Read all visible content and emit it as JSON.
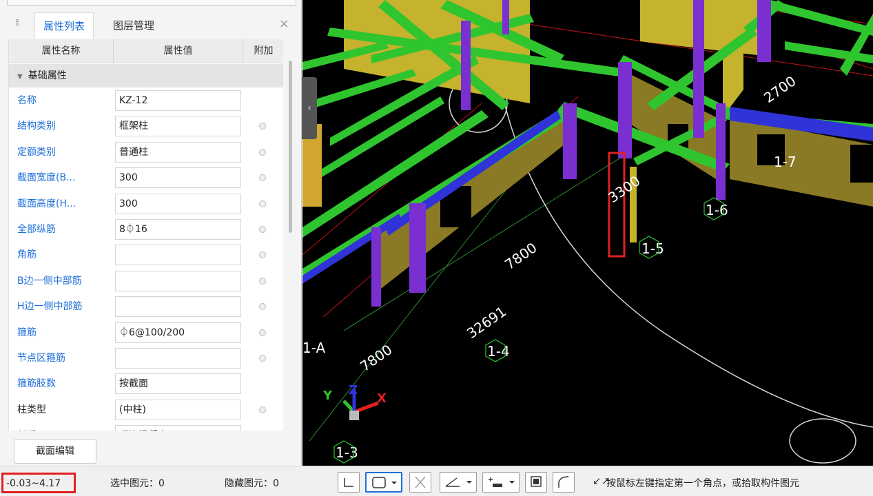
{
  "tabs": {
    "properties": "属性列表",
    "layers": "图层管理"
  },
  "close_glyph": "×",
  "columns": {
    "name": "属性名称",
    "value": "属性值",
    "extra": "附加"
  },
  "section": {
    "label": "基础属性",
    "toggle_glyph": "▼"
  },
  "rows": [
    {
      "label": "名称",
      "value": "KZ-12",
      "blue": true,
      "extra": false
    },
    {
      "label": "结构类别",
      "value": "框架柱",
      "blue": true,
      "extra": true
    },
    {
      "label": "定额类别",
      "value": "普通柱",
      "blue": true,
      "extra": true
    },
    {
      "label": "截面宽度(B...",
      "value": "300",
      "blue": true,
      "extra": true
    },
    {
      "label": "截面高度(H...",
      "value": "300",
      "blue": true,
      "extra": true
    },
    {
      "label": "全部纵筋",
      "value": "8⏀16",
      "blue": true,
      "extra": true
    },
    {
      "label": "角筋",
      "value": "",
      "blue": true,
      "extra": true
    },
    {
      "label": "B边一侧中部筋",
      "value": "",
      "blue": true,
      "extra": true
    },
    {
      "label": "H边一侧中部筋",
      "value": "",
      "blue": true,
      "extra": true
    },
    {
      "label": "箍筋",
      "value": "⏀6@100/200",
      "blue": true,
      "extra": true
    },
    {
      "label": "节点区箍筋",
      "value": "",
      "blue": true,
      "extra": true
    },
    {
      "label": "箍筋肢数",
      "value": "按截面",
      "blue": true,
      "extra": false
    },
    {
      "label": "柱类型",
      "value": "(中柱)",
      "blue": false,
      "extra": true
    },
    {
      "label": "材质",
      "value": "现浇混凝土",
      "blue": true,
      "extra": true
    }
  ],
  "buttons": {
    "section_edit": "截面编辑"
  },
  "status": {
    "elevation": "-0.03~4.17",
    "selected": "选中图元：0",
    "hidden": "隐藏图元：0",
    "hint_icon": "↙↗",
    "hint": "按鼠标左键指定第一个角点，或拾取构件图元"
  },
  "viewport": {
    "dimensions": [
      "7800",
      "7800",
      "32691",
      "3300",
      "2700"
    ],
    "axis_labels": [
      "1-3",
      "1-4",
      "1-5",
      "1-6",
      "1-7",
      "1-A"
    ],
    "axes": {
      "x": "X",
      "y": "Y",
      "z": "Z"
    }
  },
  "colors": {
    "accent_blue": "#1e6fd9",
    "beam_green": "#2fc52f",
    "wall_yellow": "#b8a52a",
    "column_purple": "#7a2fd0",
    "highlight_red": "#e02020"
  },
  "icons": [
    "grip-icon",
    "close-icon",
    "collapse-icon",
    "line-tool-icon",
    "rect-select-icon",
    "cross-select-icon",
    "angle-icon",
    "dimension-icon",
    "display-icon",
    "curve-icon"
  ]
}
